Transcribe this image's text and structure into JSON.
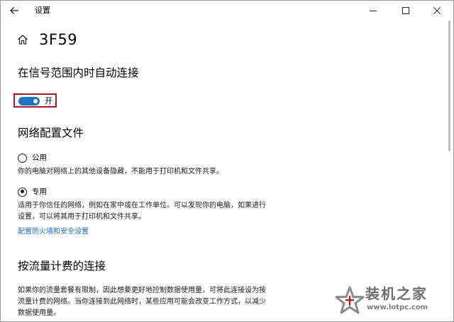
{
  "window": {
    "title": "设置"
  },
  "header": {
    "network_name": "3F59"
  },
  "auto_connect": {
    "title": "在信号范围内时自动连接",
    "toggle_state": "开",
    "toggle_on": true
  },
  "profile": {
    "title": "网络配置文件",
    "options": [
      {
        "label": "公用",
        "selected": false,
        "description": "你的电脑对网络上的其他设备隐藏，不能用于打印机和文件共享。"
      },
      {
        "label": "专用",
        "selected": true,
        "description": "适用于你信任的网络，例如在家中或在工作单位。可以发现你的电脑，如果进行设置，可以将其用于打印机和文件共享。"
      }
    ],
    "firewall_link": "配置防火墙和安全设置"
  },
  "metered": {
    "title": "按流量计费的连接",
    "description": "如果你的流量套餐有限制，因此想要更好地控制数据使用量，可将此连接设为按流量计费的网络。当你连接到此网络时，某些应用可能会改变工作方式，以减少数据使用量。"
  },
  "watermark": {
    "name": "装机之家",
    "url": "www.lotpc.com"
  },
  "colors": {
    "accent": "#1a73cf",
    "link": "#1a6fc4",
    "highlight_border": "#c8101c"
  },
  "icons": {
    "back": "back-arrow-icon",
    "home": "home-icon",
    "minimize": "minimize-icon",
    "maximize": "maximize-icon",
    "close": "close-icon"
  }
}
